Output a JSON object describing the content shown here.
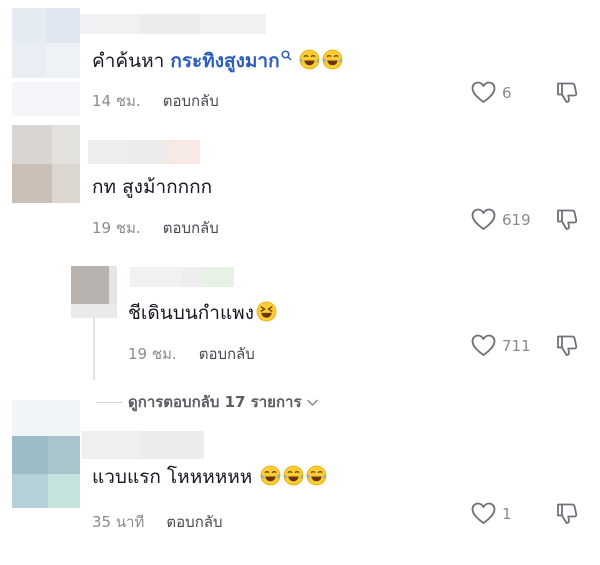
{
  "comments": [
    {
      "text_prefix": "คำค้นหา ",
      "search_term": "กระทิงสูงมาก",
      "emoji": [
        "laughing-tears",
        "laughing-tears"
      ],
      "time": "14 ชม.",
      "reply_label": "ตอบกลับ",
      "likes": "6"
    },
    {
      "text": "กท สูงม้ากกกก",
      "time": "19 ชม.",
      "reply_label": "ตอบกลับ",
      "likes": "619"
    },
    {
      "text": "ชีเดินบนกำแพง",
      "emoji": [
        "grinning-squint"
      ],
      "time": "19 ชม.",
      "reply_label": "ตอบกลับ",
      "likes": "711"
    },
    {
      "text": "แวบแรก โหหหหหห",
      "emoji": [
        "laughing-tears",
        "laughing-tears",
        "laughing-tears"
      ],
      "time": "35 นาที",
      "reply_label": "ตอบกลับ",
      "likes": "1"
    }
  ],
  "view_replies_label": "ดูการตอบกลับ 17 รายการ",
  "colors": {
    "search_link": "#2b5db9",
    "meta_text": "#8a8b91",
    "reply_text": "#4a4b52"
  }
}
